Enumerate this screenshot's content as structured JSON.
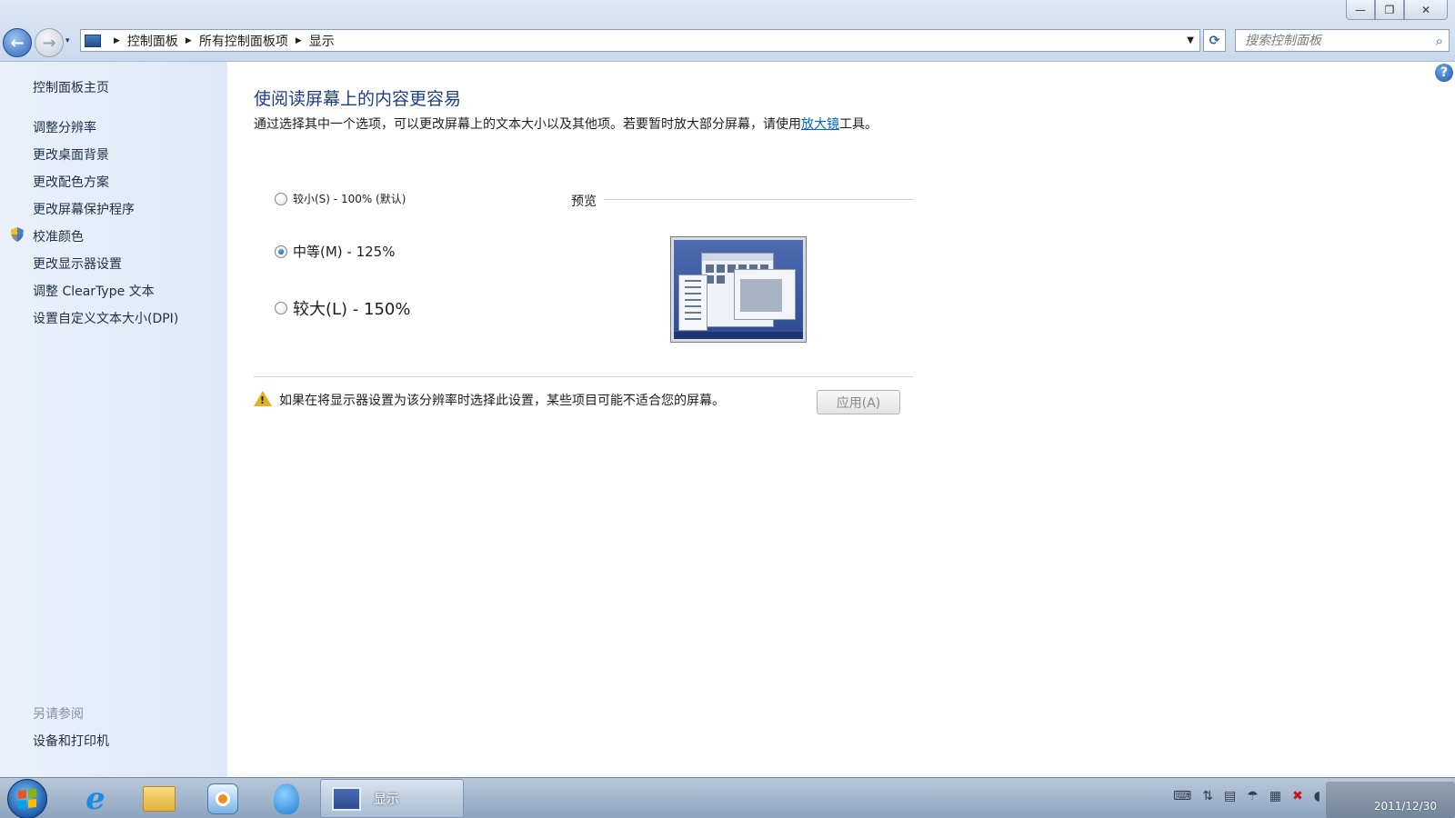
{
  "window": {
    "controls": {
      "minimize": "—",
      "restore": "❐",
      "close": "✕"
    }
  },
  "nav": {
    "back_icon": "←",
    "forward_icon": "→",
    "recent_icon": "▾",
    "breadcrumb": [
      "控制面板",
      "所有控制面板项",
      "显示"
    ],
    "refresh_icon": "⟳",
    "search_placeholder": "搜索控制面板",
    "search_icon": "⌕"
  },
  "sidebar": {
    "home": "控制面板主页",
    "links": [
      "调整分辨率",
      "更改桌面背景",
      "更改配色方案",
      "更改屏幕保护程序",
      "校准颜色",
      "更改显示器设置",
      "调整 ClearType 文本",
      "设置自定义文本大小(DPI)"
    ],
    "see_also_title": "另请参阅",
    "see_also_links": [
      "设备和打印机"
    ]
  },
  "main": {
    "help_icon": "?",
    "heading": "使阅读屏幕上的内容更容易",
    "description_pre": "通过选择其中一个选项，可以更改屏幕上的文本大小以及其他项。若要暂时放大部分屏幕，请使用",
    "description_link": "放大镜",
    "description_post": "工具。",
    "options": [
      {
        "label": "较小(S) - 100% (默认)",
        "checked": false
      },
      {
        "label": "中等(M) - 125%",
        "checked": true
      },
      {
        "label": "较大(L) - 150%",
        "checked": false
      }
    ],
    "preview_label": "预览",
    "warning_icon": "!",
    "warning_text": "如果在将显示器设置为该分辨率时选择此设置，某些项目可能不适合您的屏幕。",
    "apply_button": "应用(A)"
  },
  "taskbar": {
    "active_task": "显示",
    "clock_date": "2011/12/30",
    "tray_icons": [
      "keyboard-icon",
      "network-icon",
      "security-icon",
      "umbrella-icon",
      "display-icon",
      "error-icon",
      "volume-icon"
    ]
  }
}
